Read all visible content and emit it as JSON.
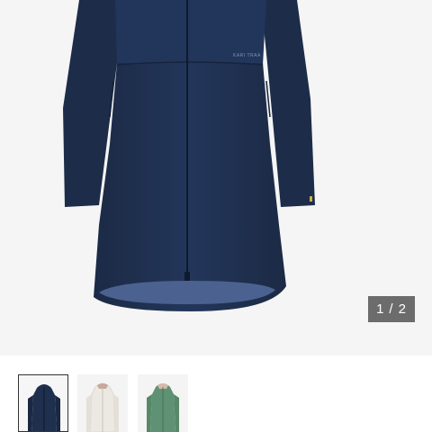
{
  "product": {
    "brand_mark": "KARI TRAA",
    "colors": {
      "selected_variant": "#1f2f4e",
      "white_variant": "#ece9e2",
      "green_variant": "#5f9274"
    }
  },
  "gallery": {
    "current": "1",
    "separator": "/",
    "total": "2"
  },
  "thumbnails": [
    {
      "icon": "navy-jacket-thumbnail",
      "color": "#1f2f4e",
      "selected": true
    },
    {
      "icon": "white-jacket-thumbnail",
      "color": "#ece9e2",
      "selected": false
    },
    {
      "icon": "green-jacket-thumbnail",
      "color": "#5f9274",
      "selected": false
    }
  ]
}
